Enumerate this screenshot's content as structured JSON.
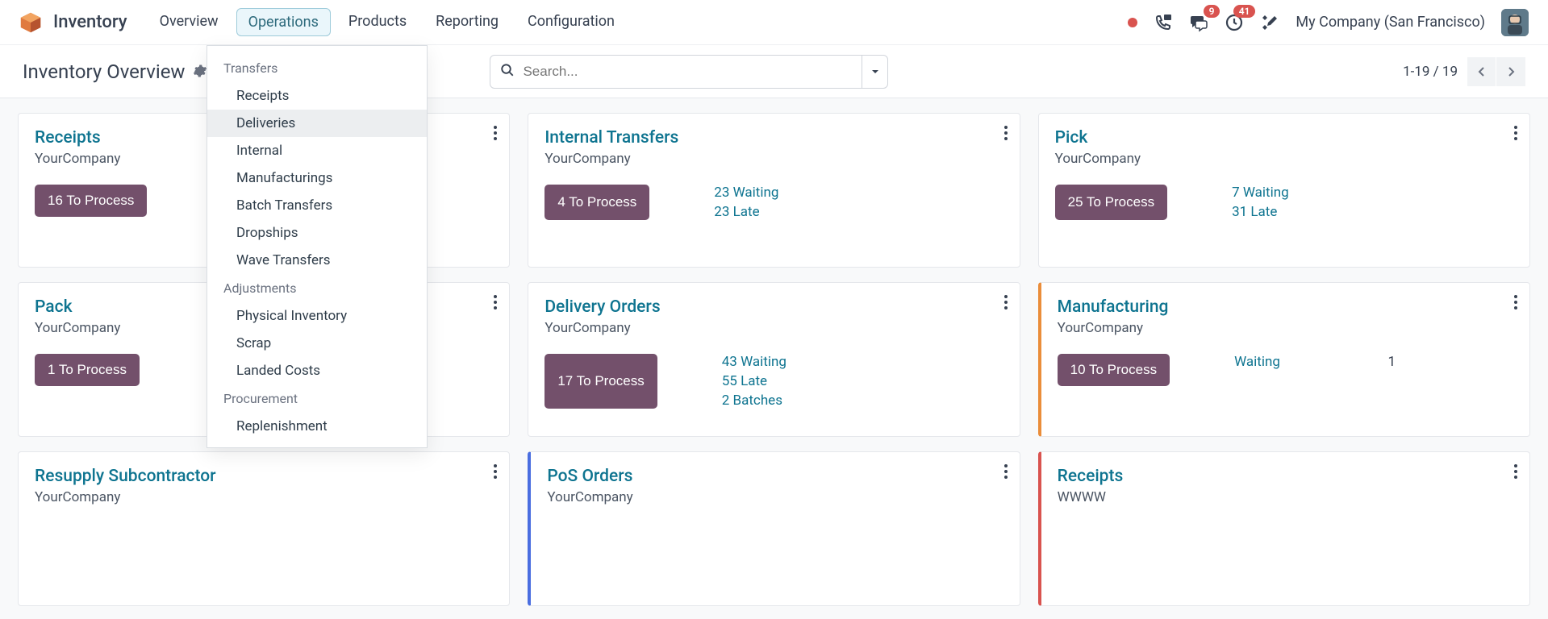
{
  "app": {
    "title": "Inventory"
  },
  "nav": {
    "overview": "Overview",
    "operations": "Operations",
    "products": "Products",
    "reporting": "Reporting",
    "configuration": "Configuration"
  },
  "topbar": {
    "msg_badge": "9",
    "act_badge": "41",
    "company": "My Company (San Francisco)"
  },
  "page": {
    "title": "Inventory Overview",
    "search_placeholder": "Search...",
    "pager": "1-19 / 19"
  },
  "dropdown": {
    "sec1": "Transfers",
    "i1": "Receipts",
    "i2": "Deliveries",
    "i3": "Internal",
    "i4": "Manufacturings",
    "i5": "Batch Transfers",
    "i6": "Dropships",
    "i7": "Wave Transfers",
    "sec2": "Adjustments",
    "i8": "Physical Inventory",
    "i9": "Scrap",
    "i10": "Landed Costs",
    "sec3": "Procurement",
    "i11": "Replenishment"
  },
  "cards": {
    "c1": {
      "title": "Receipts",
      "sub": "YourCompany",
      "btn": "16 To Process"
    },
    "c2": {
      "title": "Internal Transfers",
      "sub": "YourCompany",
      "btn": "4 To Process",
      "s1": "23 Waiting",
      "s2": "23 Late"
    },
    "c3": {
      "title": "Pick",
      "sub": "YourCompany",
      "btn": "25 To Process",
      "s1": "7 Waiting",
      "s2": "31 Late"
    },
    "c4": {
      "title": "Pack",
      "sub": "YourCompany",
      "btn": "1 To Process"
    },
    "c5": {
      "title": "Delivery Orders",
      "sub": "YourCompany",
      "btn": "17 To Process",
      "s1": "43 Waiting",
      "s2": "55 Late",
      "s3": "2 Batches"
    },
    "c6": {
      "title": "Manufacturing",
      "sub": "YourCompany",
      "btn": "10 To Process",
      "s1l": "Waiting",
      "s1v": "1"
    },
    "c7": {
      "title": "Resupply Subcontractor",
      "sub": "YourCompany"
    },
    "c8": {
      "title": "PoS Orders",
      "sub": "YourCompany"
    },
    "c9": {
      "title": "Receipts",
      "sub": "WWWW"
    }
  }
}
